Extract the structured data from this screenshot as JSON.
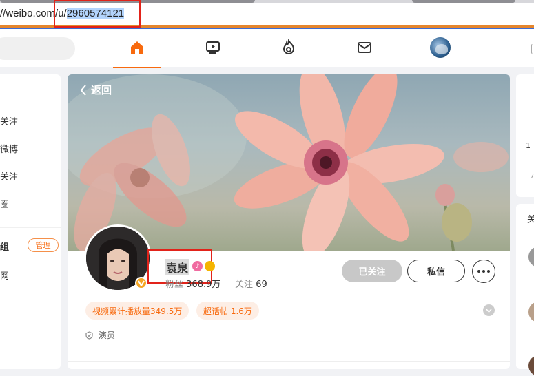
{
  "browser": {
    "url_prefix": "//weibo.com/u/",
    "url_id": "2960574121"
  },
  "nav": {
    "icons": [
      "home-icon",
      "video-icon",
      "hot-icon",
      "message-icon"
    ]
  },
  "sidebar": {
    "items": [
      {
        "label": "关注"
      },
      {
        "label": "微博"
      },
      {
        "label": "关注"
      },
      {
        "label": "圈"
      },
      {
        "label": "组"
      },
      {
        "label": "网"
      }
    ],
    "manage_label": "管理"
  },
  "cover": {
    "back_label": "返回"
  },
  "profile": {
    "name": "袁泉",
    "fans_label": "粉丝",
    "fans_value": "368.9万",
    "follow_label": "关注",
    "follow_value": "69",
    "followed_button": "已关注",
    "message_button": "私信",
    "tags": [
      "视频累计播放量349.5万",
      "超话帖 1.6万"
    ],
    "role": "演员"
  },
  "right_col": {
    "t1": "1",
    "t2": "7",
    "t3": "关"
  },
  "colors": {
    "accent": "#f86a0e",
    "highlight_box": "#e2231a"
  }
}
